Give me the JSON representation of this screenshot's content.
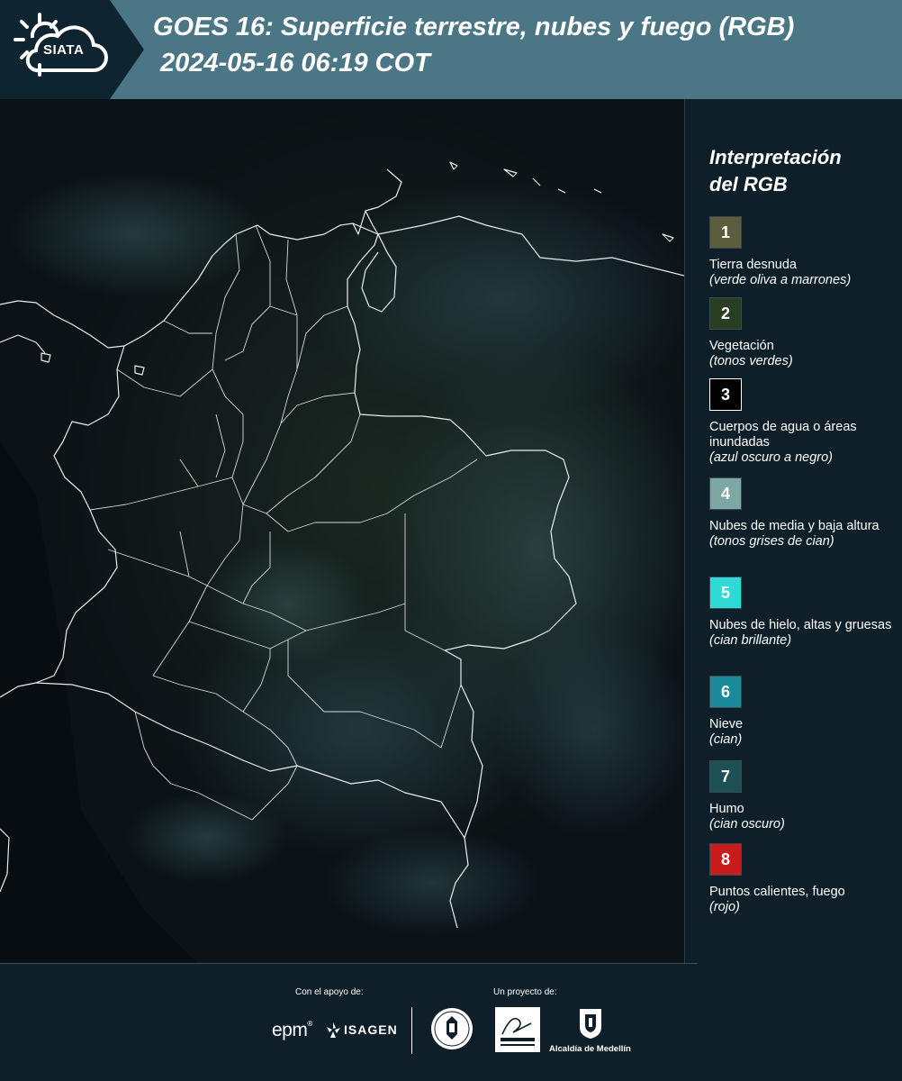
{
  "header": {
    "logo_text": "SIATA",
    "title_line1": "GOES 16: Superficie terrestre, nubes y fuego (RGB)",
    "title_line2": "2024-05-16 06:19 COT",
    "bg_color": "#4b7685",
    "logo_panel_color": "#0f2431"
  },
  "legend": {
    "title_line1": "Interpretación",
    "title_line2": "del RGB",
    "items": [
      {
        "number": "1",
        "label": "Tierra desnuda",
        "desc": "(verde oliva a marrones)",
        "color": "#5b5d3c"
      },
      {
        "number": "2",
        "label": "Vegetación",
        "desc": "(tonos verdes)",
        "color": "#2a3f22"
      },
      {
        "number": "3",
        "label": "Cuerpos de agua o áreas inundadas",
        "desc": "(azul oscuro a negro)",
        "color": "#000000"
      },
      {
        "number": "4",
        "label": "Nubes de media y baja altura",
        "desc": "(tonos grises de cian)",
        "color": "#7da7a4"
      },
      {
        "number": "5",
        "label": "Nubes de hielo, altas y gruesas",
        "desc": "(cian brillante)",
        "color": "#2fdad6"
      },
      {
        "number": "6",
        "label": "Nieve",
        "desc": "(cian)",
        "color": "#1a8a9b"
      },
      {
        "number": "7",
        "label": "Humo",
        "desc": "(cian oscuro)",
        "color": "#1e5156"
      },
      {
        "number": "8",
        "label": "Puntos calientes, fuego",
        "desc": "(rojo)",
        "color": "#c91c1c"
      }
    ]
  },
  "footer": {
    "support_caption": "Con el apoyo de:",
    "project_caption": "Un proyecto de:",
    "epm_text": "epm",
    "epm_mark": "®",
    "isagen_text": "ISAGEN",
    "medellin_text": "Alcaldía de Medellín"
  }
}
